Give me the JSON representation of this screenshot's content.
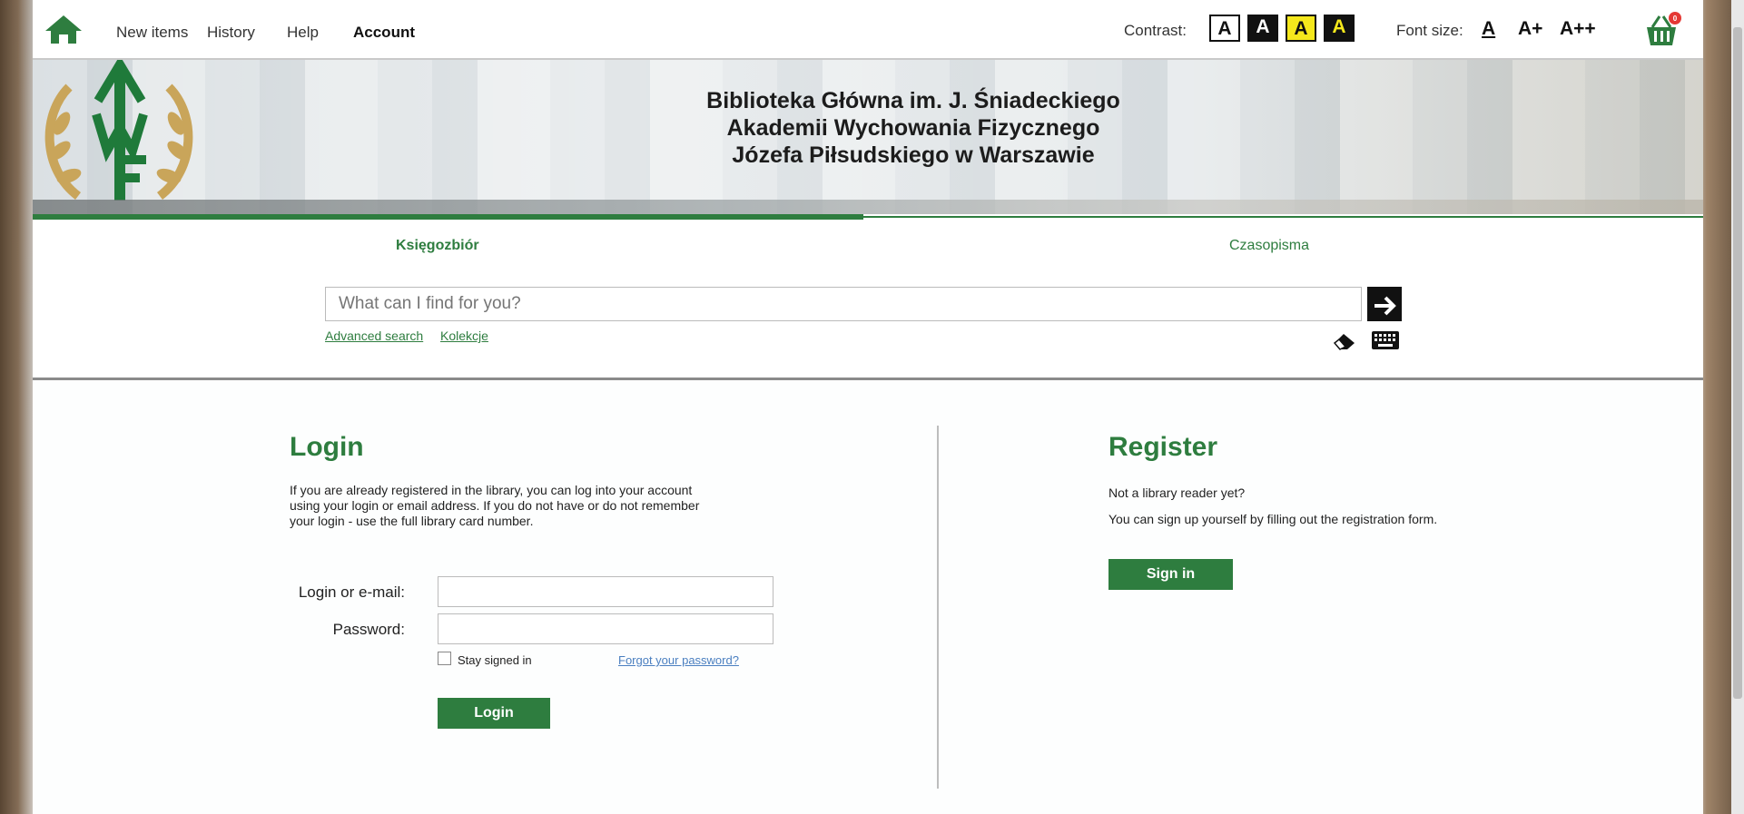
{
  "nav": {
    "items": [
      {
        "label": "New items"
      },
      {
        "label": "History"
      },
      {
        "label": "Help"
      },
      {
        "label": "Account"
      }
    ],
    "active": "Account"
  },
  "accessibility": {
    "contrast_label": "Contrast:",
    "contrast_options": [
      {
        "label": "A",
        "bg": "#ffffff",
        "fg": "#111111"
      },
      {
        "label": "A",
        "bg": "#111111",
        "fg": "#ffffff"
      },
      {
        "label": "A",
        "bg": "#f5e81c",
        "fg": "#111111"
      },
      {
        "label": "A",
        "bg": "#111111",
        "fg": "#f5e81c"
      }
    ],
    "font_size_label": "Font size:",
    "font_sizes": [
      "A",
      "A+",
      "A++"
    ]
  },
  "basket": {
    "count": "0"
  },
  "banner": {
    "title_lines": [
      "Biblioteka Główna im. J. Śniadeckiego",
      "Akademii Wychowania Fizycznego",
      "Józefa Piłsudskiego w Warszawie"
    ],
    "logo_letters": "AWF"
  },
  "search": {
    "tabs": [
      "Księgozbiór",
      "Czasopisma"
    ],
    "active_tab": "Księgozbiór",
    "placeholder": "What can I find for you?",
    "submit_icon": "arrow-right-icon",
    "links": [
      "Advanced search",
      "Kolekcje"
    ]
  },
  "login": {
    "heading": "Login",
    "description": "If you are already registered in the library, you can log into your account using your login or email address. If you do not have or do not remember your login - use the full library card number.",
    "login_label": "Login or e-mail:",
    "password_label": "Password:",
    "stay_signed_label": "Stay signed in",
    "forgot_label": "Forgot your password?",
    "button_label": "Login"
  },
  "register": {
    "heading": "Register",
    "line1": "Not a library reader yet?",
    "line2": "You can sign up yourself by filling out the registration form.",
    "button_label": "Sign in"
  },
  "colors": {
    "brand_green": "#2e7d3f",
    "link_blue": "#4a7fc0",
    "basket_badge": "#e53935"
  }
}
